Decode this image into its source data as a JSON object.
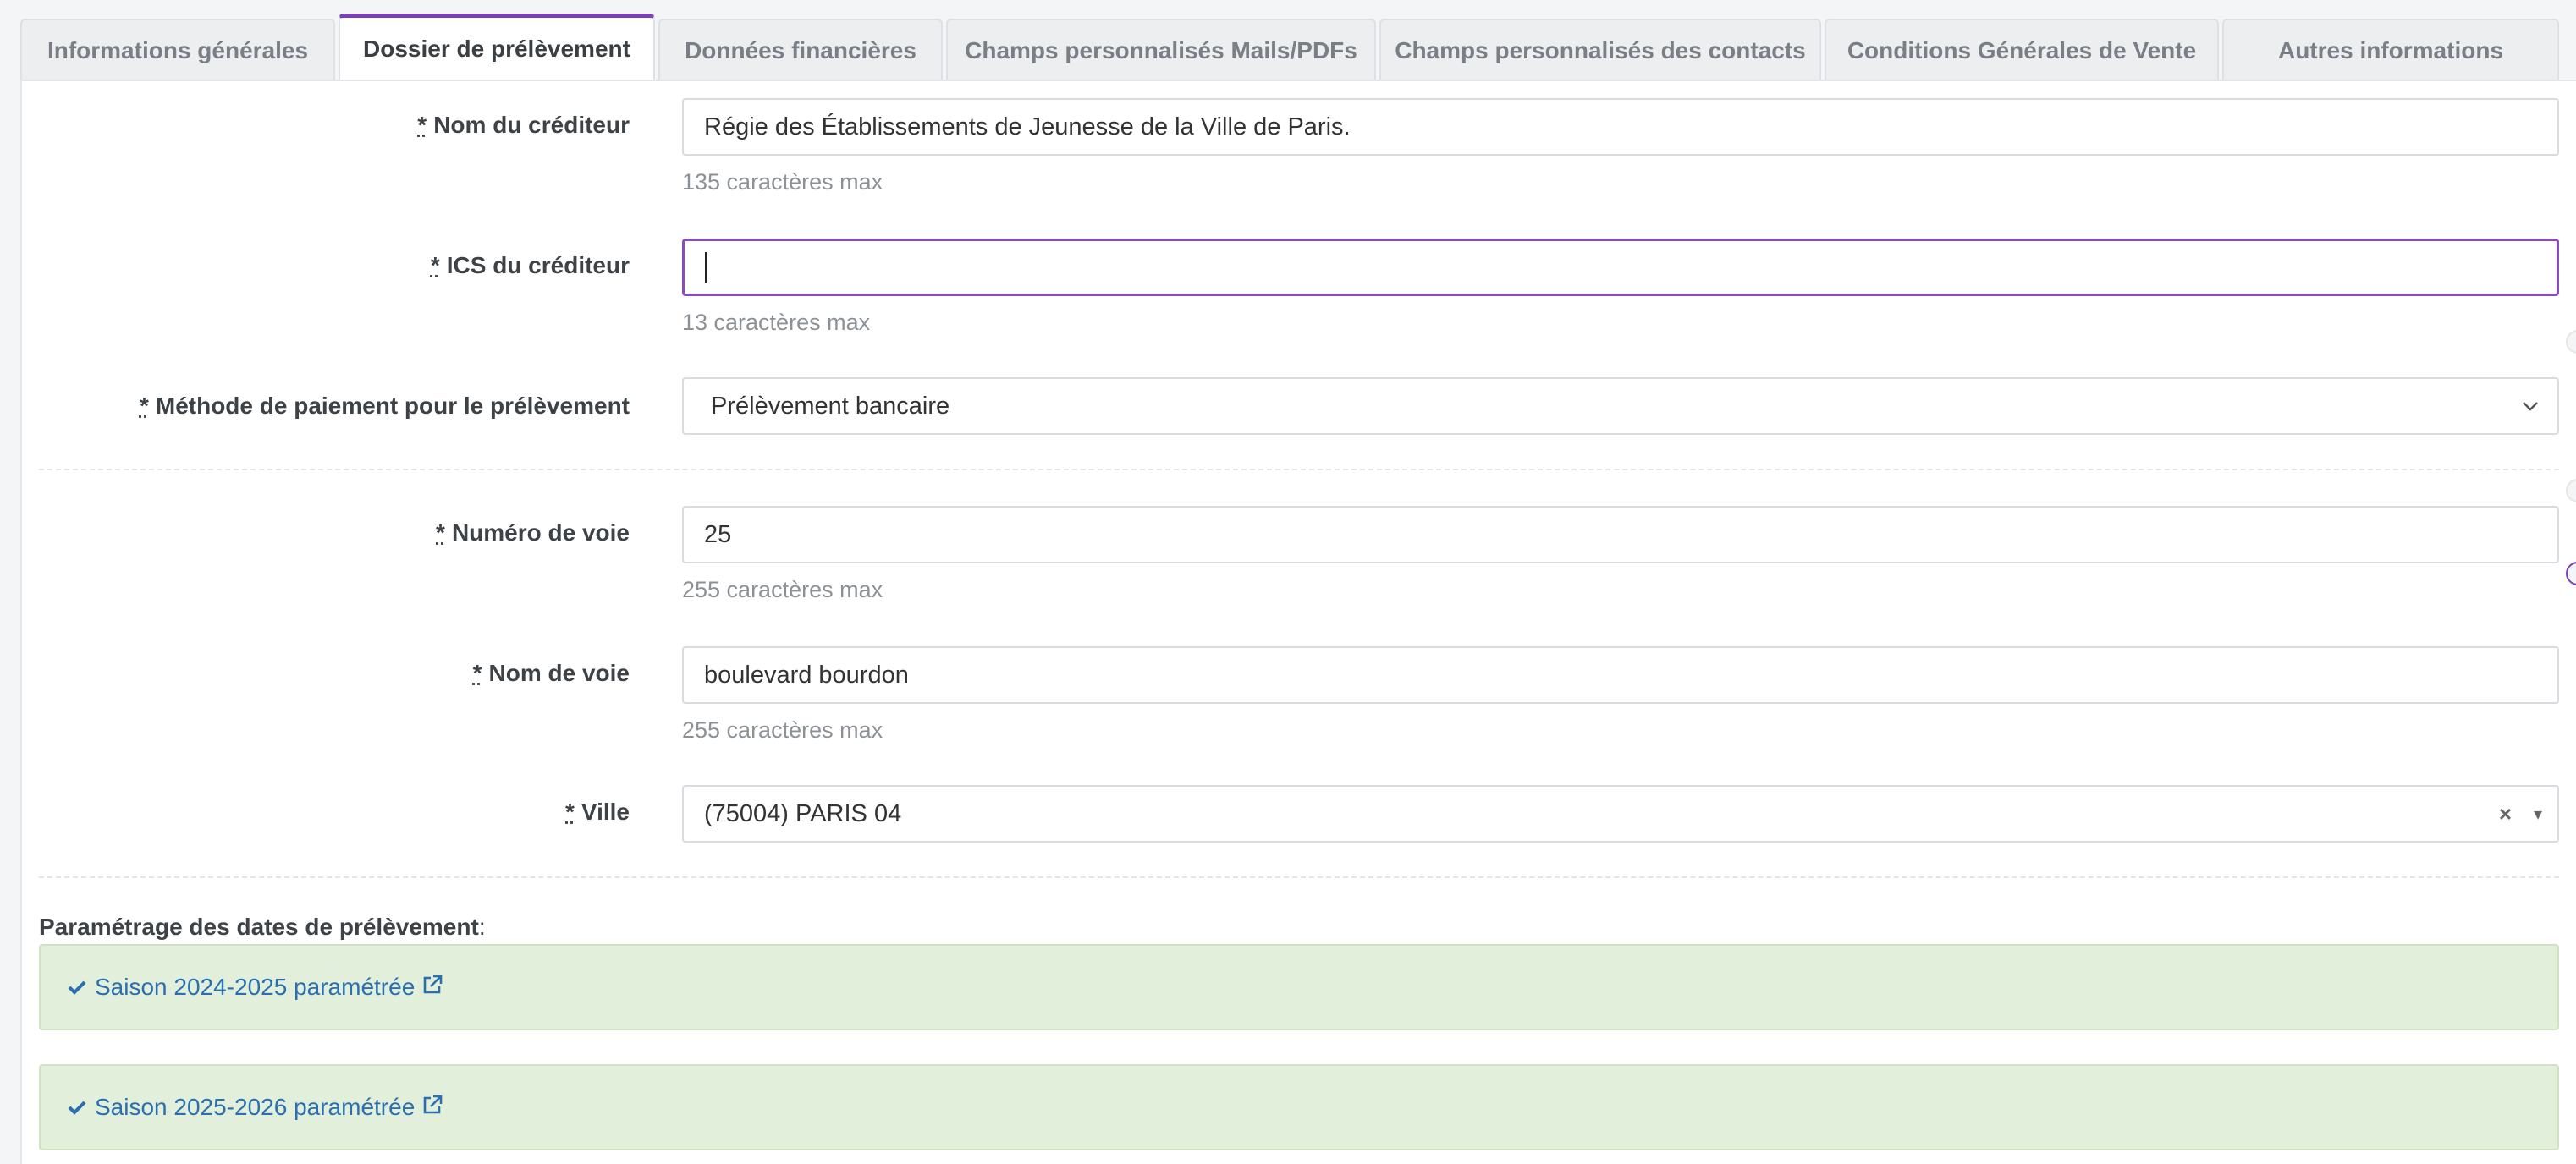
{
  "tabs": [
    {
      "label": "Informations générales"
    },
    {
      "label": "Dossier de prélèvement"
    },
    {
      "label": "Données financières"
    },
    {
      "label": "Champs personnalisés Mails/PDFs"
    },
    {
      "label": "Champs personnalisés des contacts"
    },
    {
      "label": "Conditions Générales de Vente"
    },
    {
      "label": "Autres informations"
    }
  ],
  "required_mark": "*",
  "form": {
    "creditor_name": {
      "label": "Nom du créditeur",
      "value": "Régie des Établissements de Jeunesse de la Ville de Paris.",
      "help": "135 caractères max"
    },
    "creditor_ics": {
      "label": "ICS du créditeur",
      "value": "",
      "help": "13 caractères max"
    },
    "payment_method": {
      "label": "Méthode de paiement pour le prélèvement",
      "value": "Prélèvement bancaire"
    },
    "street_number": {
      "label": "Numéro de voie",
      "value": "25",
      "help": "255 caractères max"
    },
    "street_name": {
      "label": "Nom de voie",
      "value": "boulevard bourdon",
      "help": "255 caractères max"
    },
    "city": {
      "label": "Ville",
      "value": "(75004) PARIS 04",
      "clear": "×",
      "arrow": "▾"
    }
  },
  "dates_section": {
    "title": "Paramétrage des dates de prélèvement",
    "colon": ":",
    "seasons": [
      {
        "label": "Saison 2024-2025 paramétrée"
      },
      {
        "label": "Saison 2025-2026 paramétrée"
      }
    ]
  },
  "colors": {
    "accent": "#7b3fb8",
    "success_bg": "#e1efdb",
    "link": "#2a6fb0"
  }
}
